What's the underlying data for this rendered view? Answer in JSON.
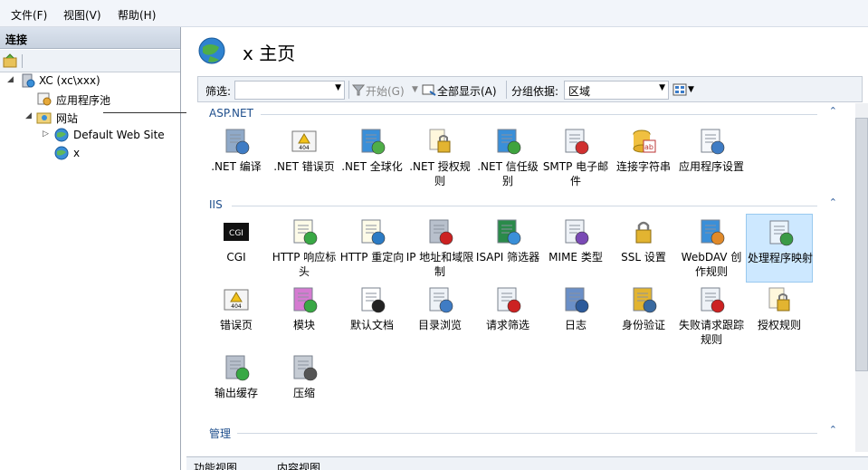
{
  "menu": {
    "file": "文件(F)",
    "view": "视图(V)",
    "help": "帮助(H)"
  },
  "connections": {
    "header": "连接",
    "tree": {
      "server": "XC (xc\\xxx)",
      "app_pools": "应用程序池",
      "sites": "网站",
      "default_site": "Default Web Site",
      "site_x": "x"
    }
  },
  "page": {
    "title": "x 主页",
    "filter_label": "筛选:",
    "start_label": "开始(G)",
    "show_all_label": "全部显示(A)",
    "group_by_label": "分组依据:",
    "group_by_value": "区域"
  },
  "groups": {
    "aspnet": "ASP.NET",
    "iis": "IIS",
    "management": "管理"
  },
  "aspnet_features": [
    {
      "label": ".NET 编译",
      "icon": "dotnet-compilation-icon"
    },
    {
      "label": ".NET 错误页",
      "icon": "dotnet-error-pages-icon"
    },
    {
      "label": ".NET 全球化",
      "icon": "dotnet-globalization-icon"
    },
    {
      "label": ".NET 授权规则",
      "icon": "dotnet-authorization-icon"
    },
    {
      "label": ".NET 信任级别",
      "icon": "dotnet-trust-levels-icon"
    },
    {
      "label": "SMTP 电子邮件",
      "icon": "smtp-email-icon"
    },
    {
      "label": "连接字符串",
      "icon": "connection-strings-icon"
    },
    {
      "label": "应用程序设置",
      "icon": "application-settings-icon"
    }
  ],
  "iis_features": [
    {
      "label": "CGI",
      "icon": "cgi-icon"
    },
    {
      "label": "HTTP 响应标头",
      "icon": "http-response-headers-icon"
    },
    {
      "label": "HTTP 重定向",
      "icon": "http-redirect-icon"
    },
    {
      "label": "IP 地址和域限制",
      "icon": "ip-domain-restrictions-icon"
    },
    {
      "label": "ISAPI 筛选器",
      "icon": "isapi-filters-icon"
    },
    {
      "label": "MIME 类型",
      "icon": "mime-types-icon"
    },
    {
      "label": "SSL 设置",
      "icon": "ssl-settings-icon"
    },
    {
      "label": "WebDAV 创作规则",
      "icon": "webdav-authoring-icon"
    },
    {
      "label": "处理程序映射",
      "icon": "handler-mappings-icon"
    },
    {
      "label": "错误页",
      "icon": "error-pages-icon"
    },
    {
      "label": "模块",
      "icon": "modules-icon"
    },
    {
      "label": "默认文档",
      "icon": "default-document-icon"
    },
    {
      "label": "目录浏览",
      "icon": "directory-browsing-icon"
    },
    {
      "label": "请求筛选",
      "icon": "request-filtering-icon"
    },
    {
      "label": "日志",
      "icon": "logging-icon"
    },
    {
      "label": "身份验证",
      "icon": "authentication-icon"
    },
    {
      "label": "失败请求跟踪规则",
      "icon": "failed-request-tracing-icon"
    },
    {
      "label": "授权规则",
      "icon": "authorization-rules-icon"
    },
    {
      "label": "输出缓存",
      "icon": "output-caching-icon"
    },
    {
      "label": "压缩",
      "icon": "compression-icon"
    }
  ],
  "bottom_tabs": {
    "features_view": "功能视图",
    "content_view": "内容视图"
  },
  "colors": {
    "accent": "#1e4e8c",
    "selected": "#cde8ff"
  }
}
